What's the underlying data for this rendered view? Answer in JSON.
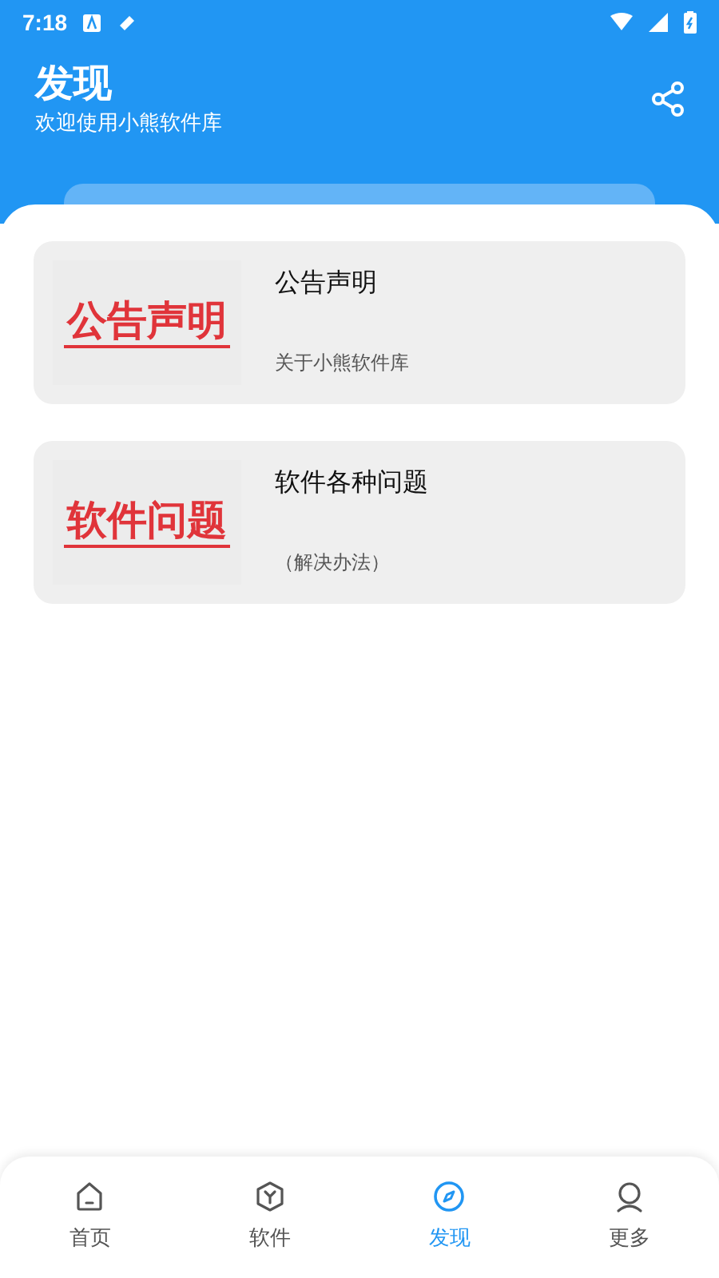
{
  "status_bar": {
    "time": "7:18"
  },
  "header": {
    "title": "发现",
    "subtitle": "欢迎使用小熊软件库"
  },
  "cards": [
    {
      "thumbnail_text": "公告声明",
      "title": "公告声明",
      "subtitle": "关于小熊软件库"
    },
    {
      "thumbnail_text": "软件问题",
      "title": "软件各种问题",
      "subtitle": "（解决办法）"
    }
  ],
  "tabs": [
    {
      "label": "首页",
      "kind": "home",
      "selected": false
    },
    {
      "label": "软件",
      "kind": "software",
      "selected": false
    },
    {
      "label": "发现",
      "kind": "discover",
      "selected": true
    },
    {
      "label": "更多",
      "kind": "more",
      "selected": false
    }
  ]
}
